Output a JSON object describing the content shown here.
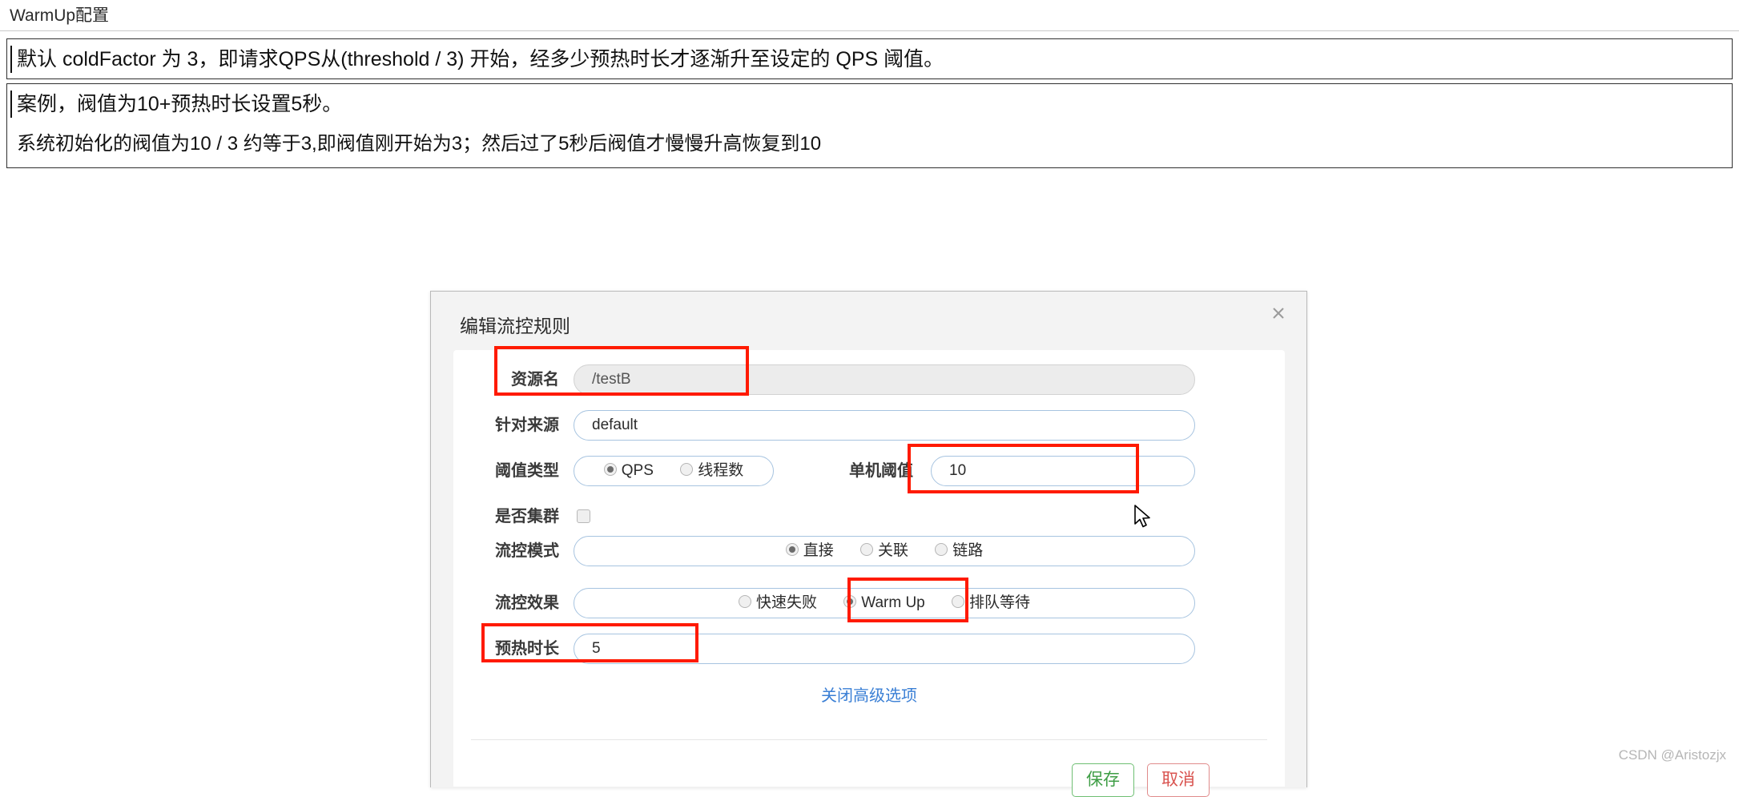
{
  "page": {
    "title": "WarmUp配置",
    "watermark": "CSDN @Aristozjx"
  },
  "notes": {
    "box1": [
      "默认 coldFactor 为 3，即请求QPS从(threshold / 3) 开始，经多少预热时长才逐渐升至设定的 QPS 阈值。"
    ],
    "box2": [
      "案例，阀值为10+预热时长设置5秒。",
      "系统初始化的阀值为10 / 3 约等于3,即阀值刚开始为3；然后过了5秒后阀值才慢慢升高恢复到10"
    ]
  },
  "dialog": {
    "title": "编辑流控规则",
    "close_icon": "close-icon",
    "advanced_link": "关闭高级选项",
    "buttons": {
      "save": "保存",
      "cancel": "取消"
    },
    "fields": {
      "resource": {
        "label": "资源名",
        "value": "/testB",
        "disabled": true
      },
      "origin": {
        "label": "针对来源",
        "value": "default"
      },
      "threshold_type": {
        "label": "阈值类型",
        "options": [
          "QPS",
          "线程数"
        ],
        "selected": "QPS"
      },
      "single_threshold": {
        "label": "单机阈值",
        "value": "10"
      },
      "is_cluster": {
        "label": "是否集群",
        "checked": false
      },
      "flow_mode": {
        "label": "流控模式",
        "options": [
          "直接",
          "关联",
          "链路"
        ],
        "selected": "直接"
      },
      "flow_effect": {
        "label": "流控效果",
        "options": [
          "快速失败",
          "Warm Up",
          "排队等待"
        ],
        "selected": "Warm Up"
      },
      "warmup_duration": {
        "label": "预热时长",
        "value": "5"
      }
    }
  },
  "colors": {
    "annotation": "#ff1a00",
    "link": "#3a7fd5",
    "save": "#3f9e46",
    "cancel": "#d9534f"
  }
}
